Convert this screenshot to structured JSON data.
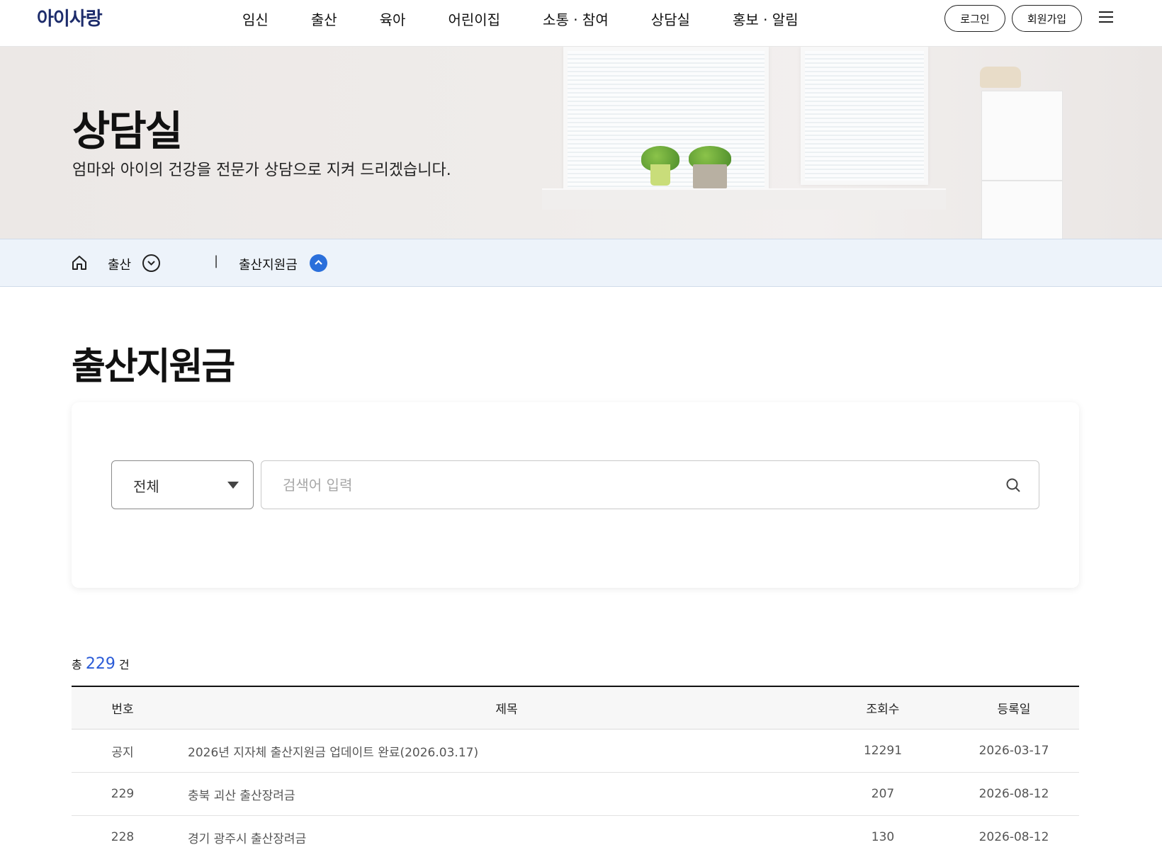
{
  "header": {
    "logo": "아이사랑",
    "nav": [
      "임신",
      "출산",
      "육아",
      "어린이집",
      "소통 · 참여",
      "상담실",
      "홍보 · 알림"
    ],
    "login_label": "로그인",
    "join_label": "회원가입"
  },
  "hero": {
    "title": "상담실",
    "subtitle": "엄마와 아이의 건강을 전문가 상담으로 지켜 드리겠습니다."
  },
  "breadcrumb": {
    "level1": "출산",
    "separator": "|",
    "level2": "출산지원금"
  },
  "page": {
    "title": "출산지원금"
  },
  "search": {
    "select_value": "전체",
    "placeholder": "검색어 입력"
  },
  "count": {
    "prefix": "총",
    "value": "229",
    "suffix": "건"
  },
  "table": {
    "headers": [
      "번호",
      "제목",
      "조회수",
      "등록일"
    ],
    "rows": [
      {
        "no": "공지",
        "title": "2026년 지자체 출산지원금 업데이트 완료(2026.03.17)",
        "views": "12291",
        "date": "2026-03-17"
      },
      {
        "no": "229",
        "title": "충북 괴산 출산장려금",
        "views": "207",
        "date": "2026-08-12"
      },
      {
        "no": "228",
        "title": "경기 광주시 출산장려금",
        "views": "130",
        "date": "2026-08-12"
      }
    ]
  },
  "colors": {
    "accent": "#2a6fdb",
    "count_accent": "#2a5bd7",
    "breadcrumb_bg": "#edf3fa",
    "logo": "#1d2c6b"
  }
}
